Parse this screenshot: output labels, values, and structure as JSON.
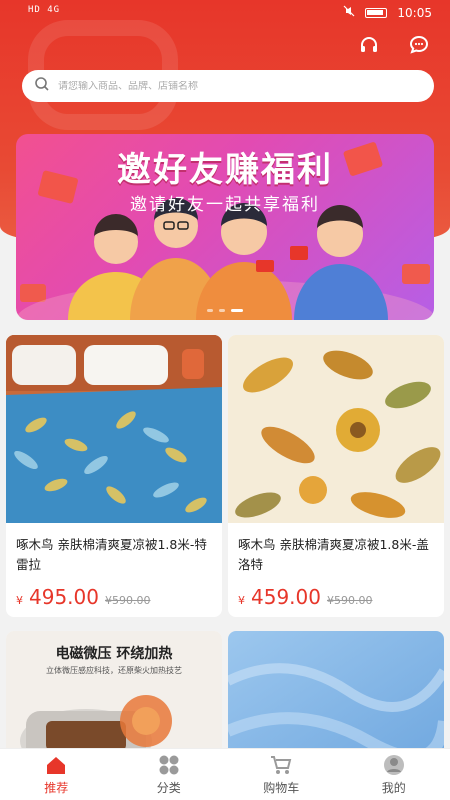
{
  "status_bar": {
    "signal": "HD 4G",
    "time": "10:05"
  },
  "header": {
    "service_icon": "headset-icon",
    "message_icon": "chat-bubble-icon"
  },
  "search": {
    "placeholder": "请您输入商品、品牌、店铺名称",
    "icon": "search-icon"
  },
  "banner": {
    "title": "邀好友赚福利",
    "subtitle": "邀请好友一起共享福利",
    "slide_count": 3,
    "active_slide": 2
  },
  "products": [
    {
      "name": "啄木鸟 亲肤棉清爽夏凉被1.8米-特雷拉",
      "currency": "¥",
      "price": "495.00",
      "original_price": "¥590.00"
    },
    {
      "name": "啄木鸟 亲肤棉清爽夏凉被1.8米-盖洛特",
      "currency": "¥",
      "price": "459.00",
      "original_price": "¥590.00"
    },
    {
      "name": "",
      "image_heading": "电磁微压 环绕加热",
      "image_caption": "立体微压感应科技，还原柴火加热技艺"
    },
    {
      "name": ""
    }
  ],
  "tabbar": {
    "items": [
      {
        "label": "推荐",
        "icon": "home-icon",
        "active": true
      },
      {
        "label": "分类",
        "icon": "category-grid-icon",
        "active": false
      },
      {
        "label": "购物车",
        "icon": "cart-icon",
        "active": false
      },
      {
        "label": "我的",
        "icon": "profile-icon",
        "active": false
      }
    ]
  },
  "colors": {
    "accent": "#e7362a",
    "banner_start": "#f25090",
    "banner_end": "#b65fe6"
  }
}
